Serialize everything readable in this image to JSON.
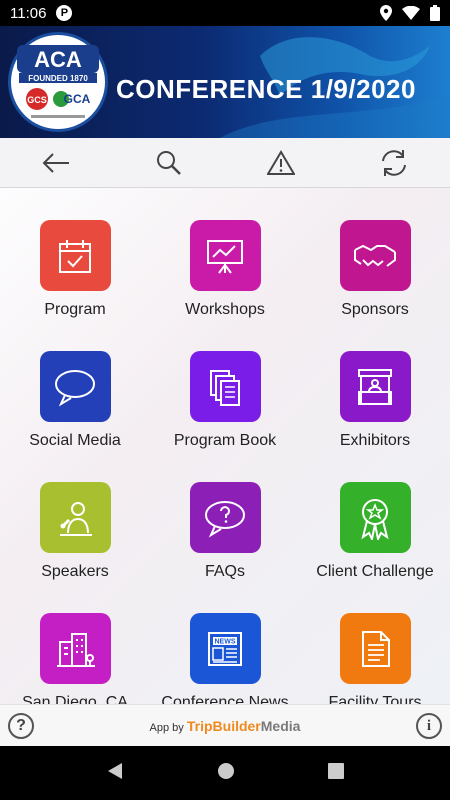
{
  "status_bar": {
    "time": "11:06",
    "app_badge": "P"
  },
  "banner": {
    "title": "CONFERENCE  1/9/2020",
    "logo_top": "ACA",
    "logo_founded": "FOUNDED 1870",
    "logo_left": "GCS",
    "logo_right": "GCA"
  },
  "toolbar": {
    "icons": [
      "back-arrow-icon",
      "search-icon",
      "alert-icon",
      "refresh-icon"
    ]
  },
  "tiles": [
    {
      "label": "Program",
      "color": "#e84b3d",
      "icon": "calendar-icon"
    },
    {
      "label": "Workshops",
      "color": "#c91aa8",
      "icon": "presentation-icon"
    },
    {
      "label": "Sponsors",
      "color": "#c0168f",
      "icon": "handshake-icon"
    },
    {
      "label": "Social Media",
      "color": "#2340b8",
      "icon": "chat-bubble-icon"
    },
    {
      "label": "Program Book",
      "color": "#7a1de8",
      "icon": "documents-icon"
    },
    {
      "label": "Exhibitors",
      "color": "#8a19c9",
      "icon": "booth-icon"
    },
    {
      "label": "Speakers",
      "color": "#a8c030",
      "icon": "speaker-icon"
    },
    {
      "label": "FAQs",
      "color": "#8c1fb5",
      "icon": "question-bubble-icon"
    },
    {
      "label": "Client Challenge",
      "color": "#34b02a",
      "icon": "award-ribbon-icon"
    },
    {
      "label": "San Diego, CA",
      "color": "#c41fc4",
      "icon": "city-icon"
    },
    {
      "label": "Conference News",
      "color": "#1a56d6",
      "icon": "newspaper-icon"
    },
    {
      "label": "Facility Tours",
      "color": "#f07a10",
      "icon": "document-icon"
    }
  ],
  "footer": {
    "help": "?",
    "info": "i",
    "credit_prefix": "App by ",
    "brand_a": "TripBuilder",
    "brand_b": "Media"
  }
}
